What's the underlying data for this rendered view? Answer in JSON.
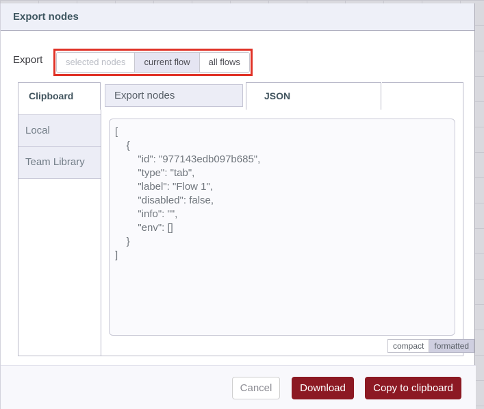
{
  "dialog": {
    "title": "Export nodes"
  },
  "export_row": {
    "label": "Export",
    "options": [
      {
        "label": "selected nodes",
        "state": "disabled"
      },
      {
        "label": "current flow",
        "state": "selected"
      },
      {
        "label": "all flows",
        "state": "normal"
      }
    ]
  },
  "tabs": {
    "clipboard": "Clipboard",
    "export_nodes": "Export nodes",
    "json": "JSON"
  },
  "library": {
    "items": [
      {
        "label": "Local"
      },
      {
        "label": "Team Library"
      }
    ]
  },
  "json_text": "[\n    {\n        \"id\": \"977143edb097b685\",\n        \"type\": \"tab\",\n        \"label\": \"Flow 1\",\n        \"disabled\": false,\n        \"info\": \"\",\n        \"env\": []\n    }\n]",
  "format_toggle": {
    "compact": "compact",
    "formatted": "formatted",
    "selected": "formatted"
  },
  "footer": {
    "cancel": "Cancel",
    "download": "Download",
    "copy": "Copy to clipboard"
  },
  "colors": {
    "brand_maroon": "#8c1923",
    "annotation_red": "#e03227",
    "selected_option_bg": "#e5e5f2",
    "header_bg": "#eef0f8",
    "tab_text": "#41545e"
  }
}
